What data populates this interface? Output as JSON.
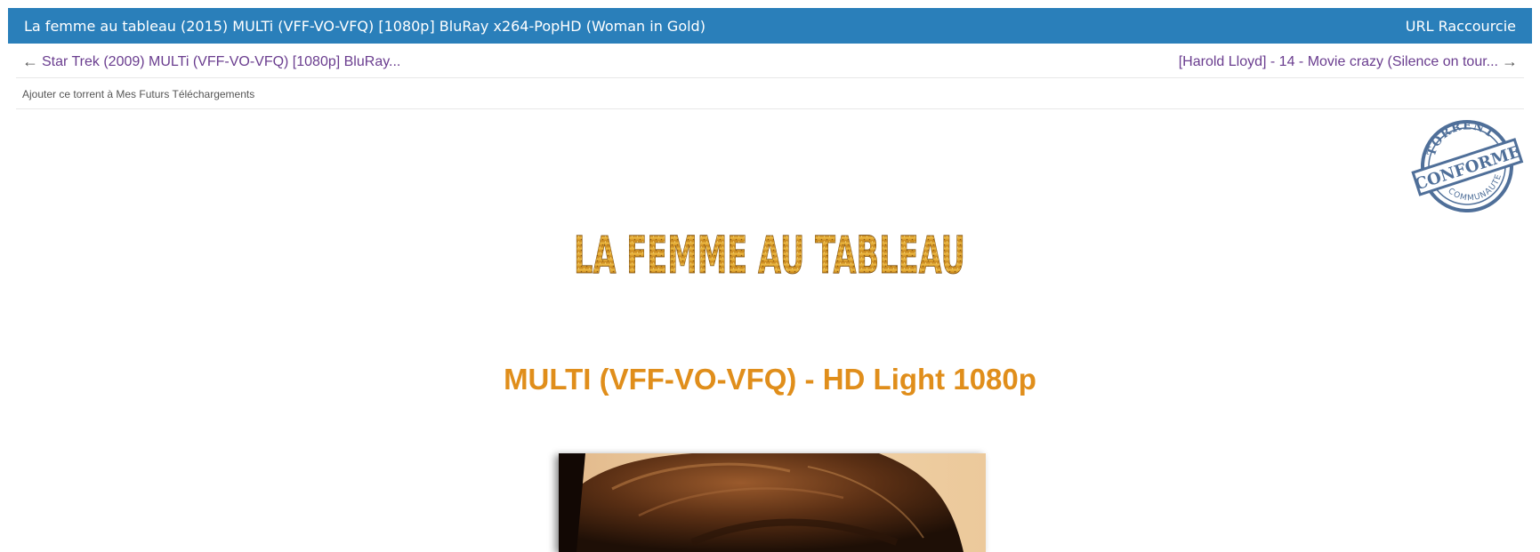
{
  "header": {
    "title": "La femme au tableau (2015) MULTi (VFF-VO-VFQ) [1080p] BluRay x264-PopHD (Woman in Gold)",
    "short_url_label": "URL Raccourcie"
  },
  "nav": {
    "prev_arrow": "←",
    "prev_label": "Star Trek (2009) MULTi (VFF-VO-VFQ) [1080p] BluRay...",
    "next_label": "[Harold Lloyd] - 14 - Movie crazy (Silence on tour...",
    "next_arrow": "→"
  },
  "actions": {
    "add_future_download": "Ajouter ce torrent à Mes Futurs Téléchargements"
  },
  "stamp": {
    "top_text": "TORRENT",
    "center_text": "CONFORME",
    "bottom_text": "COMMUNAUTE"
  },
  "content": {
    "movie_logo_text": "LA FEMME AU TABLEAU",
    "quality_heading": "MULTI (VFF-VO-VFQ) - HD Light 1080p"
  },
  "colors": {
    "header_bg": "#2a7fba",
    "link": "#6a3d8f",
    "heading_orange": "#e08e1b",
    "stamp_blue": "#4f6f99",
    "logo_gold": "#d9a02a"
  }
}
